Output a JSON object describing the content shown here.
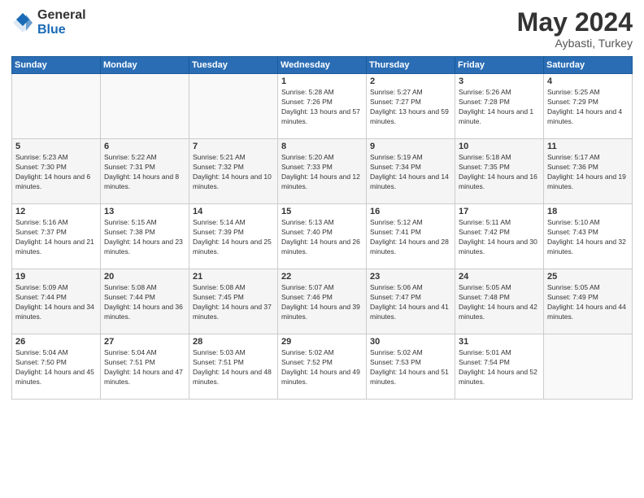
{
  "logo": {
    "general": "General",
    "blue": "Blue"
  },
  "title": "May 2024",
  "location": "Aybasti, Turkey",
  "days_of_week": [
    "Sunday",
    "Monday",
    "Tuesday",
    "Wednesday",
    "Thursday",
    "Friday",
    "Saturday"
  ],
  "weeks": [
    [
      {
        "day": "",
        "info": ""
      },
      {
        "day": "",
        "info": ""
      },
      {
        "day": "",
        "info": ""
      },
      {
        "day": "1",
        "info": "Sunrise: 5:28 AM\nSunset: 7:26 PM\nDaylight: 13 hours and 57 minutes."
      },
      {
        "day": "2",
        "info": "Sunrise: 5:27 AM\nSunset: 7:27 PM\nDaylight: 13 hours and 59 minutes."
      },
      {
        "day": "3",
        "info": "Sunrise: 5:26 AM\nSunset: 7:28 PM\nDaylight: 14 hours and 1 minute."
      },
      {
        "day": "4",
        "info": "Sunrise: 5:25 AM\nSunset: 7:29 PM\nDaylight: 14 hours and 4 minutes."
      }
    ],
    [
      {
        "day": "5",
        "info": "Sunrise: 5:23 AM\nSunset: 7:30 PM\nDaylight: 14 hours and 6 minutes."
      },
      {
        "day": "6",
        "info": "Sunrise: 5:22 AM\nSunset: 7:31 PM\nDaylight: 14 hours and 8 minutes."
      },
      {
        "day": "7",
        "info": "Sunrise: 5:21 AM\nSunset: 7:32 PM\nDaylight: 14 hours and 10 minutes."
      },
      {
        "day": "8",
        "info": "Sunrise: 5:20 AM\nSunset: 7:33 PM\nDaylight: 14 hours and 12 minutes."
      },
      {
        "day": "9",
        "info": "Sunrise: 5:19 AM\nSunset: 7:34 PM\nDaylight: 14 hours and 14 minutes."
      },
      {
        "day": "10",
        "info": "Sunrise: 5:18 AM\nSunset: 7:35 PM\nDaylight: 14 hours and 16 minutes."
      },
      {
        "day": "11",
        "info": "Sunrise: 5:17 AM\nSunset: 7:36 PM\nDaylight: 14 hours and 19 minutes."
      }
    ],
    [
      {
        "day": "12",
        "info": "Sunrise: 5:16 AM\nSunset: 7:37 PM\nDaylight: 14 hours and 21 minutes."
      },
      {
        "day": "13",
        "info": "Sunrise: 5:15 AM\nSunset: 7:38 PM\nDaylight: 14 hours and 23 minutes."
      },
      {
        "day": "14",
        "info": "Sunrise: 5:14 AM\nSunset: 7:39 PM\nDaylight: 14 hours and 25 minutes."
      },
      {
        "day": "15",
        "info": "Sunrise: 5:13 AM\nSunset: 7:40 PM\nDaylight: 14 hours and 26 minutes."
      },
      {
        "day": "16",
        "info": "Sunrise: 5:12 AM\nSunset: 7:41 PM\nDaylight: 14 hours and 28 minutes."
      },
      {
        "day": "17",
        "info": "Sunrise: 5:11 AM\nSunset: 7:42 PM\nDaylight: 14 hours and 30 minutes."
      },
      {
        "day": "18",
        "info": "Sunrise: 5:10 AM\nSunset: 7:43 PM\nDaylight: 14 hours and 32 minutes."
      }
    ],
    [
      {
        "day": "19",
        "info": "Sunrise: 5:09 AM\nSunset: 7:44 PM\nDaylight: 14 hours and 34 minutes."
      },
      {
        "day": "20",
        "info": "Sunrise: 5:08 AM\nSunset: 7:44 PM\nDaylight: 14 hours and 36 minutes."
      },
      {
        "day": "21",
        "info": "Sunrise: 5:08 AM\nSunset: 7:45 PM\nDaylight: 14 hours and 37 minutes."
      },
      {
        "day": "22",
        "info": "Sunrise: 5:07 AM\nSunset: 7:46 PM\nDaylight: 14 hours and 39 minutes."
      },
      {
        "day": "23",
        "info": "Sunrise: 5:06 AM\nSunset: 7:47 PM\nDaylight: 14 hours and 41 minutes."
      },
      {
        "day": "24",
        "info": "Sunrise: 5:05 AM\nSunset: 7:48 PM\nDaylight: 14 hours and 42 minutes."
      },
      {
        "day": "25",
        "info": "Sunrise: 5:05 AM\nSunset: 7:49 PM\nDaylight: 14 hours and 44 minutes."
      }
    ],
    [
      {
        "day": "26",
        "info": "Sunrise: 5:04 AM\nSunset: 7:50 PM\nDaylight: 14 hours and 45 minutes."
      },
      {
        "day": "27",
        "info": "Sunrise: 5:04 AM\nSunset: 7:51 PM\nDaylight: 14 hours and 47 minutes."
      },
      {
        "day": "28",
        "info": "Sunrise: 5:03 AM\nSunset: 7:51 PM\nDaylight: 14 hours and 48 minutes."
      },
      {
        "day": "29",
        "info": "Sunrise: 5:02 AM\nSunset: 7:52 PM\nDaylight: 14 hours and 49 minutes."
      },
      {
        "day": "30",
        "info": "Sunrise: 5:02 AM\nSunset: 7:53 PM\nDaylight: 14 hours and 51 minutes."
      },
      {
        "day": "31",
        "info": "Sunrise: 5:01 AM\nSunset: 7:54 PM\nDaylight: 14 hours and 52 minutes."
      },
      {
        "day": "",
        "info": ""
      }
    ]
  ]
}
